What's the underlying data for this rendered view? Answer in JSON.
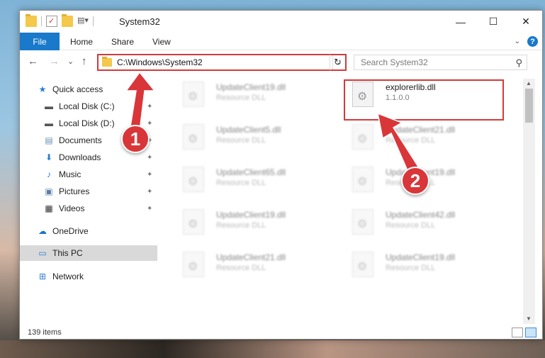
{
  "window": {
    "title": "System32",
    "controls": {
      "minimize": "—",
      "maximize": "☐",
      "close": "✕"
    }
  },
  "ribbon": {
    "tabs": [
      "File",
      "Home",
      "Share",
      "View"
    ],
    "help": "?"
  },
  "navbar": {
    "back": "←",
    "forward": "→",
    "recent": "⌄",
    "up": "↑",
    "address": "C:\\Windows\\System32",
    "refresh": "↻",
    "search_placeholder": "Search System32",
    "search_icon": "⚲"
  },
  "sidebar": {
    "items": [
      {
        "label": "Quick access",
        "icon": "star-icon",
        "glyph": "★",
        "color": "#2b7bd5",
        "pinned": false
      },
      {
        "label": "Local Disk (C:)",
        "icon": "drive-icon",
        "glyph": "▬",
        "color": "#555555",
        "pinned": true
      },
      {
        "label": "Local Disk (D:)",
        "icon": "drive-icon",
        "glyph": "▬",
        "color": "#555555",
        "pinned": true
      },
      {
        "label": "Documents",
        "icon": "documents-icon",
        "glyph": "▤",
        "color": "#6a8fb5",
        "pinned": true
      },
      {
        "label": "Downloads",
        "icon": "downloads-icon",
        "glyph": "⬇",
        "color": "#2b7bd5",
        "pinned": true
      },
      {
        "label": "Music",
        "icon": "music-icon",
        "glyph": "♪",
        "color": "#2b7bd5",
        "pinned": true
      },
      {
        "label": "Pictures",
        "icon": "pictures-icon",
        "glyph": "▣",
        "color": "#5a7ea6",
        "pinned": true
      },
      {
        "label": "Videos",
        "icon": "videos-icon",
        "glyph": "▦",
        "color": "#333333",
        "pinned": true
      },
      {
        "label": "OneDrive",
        "icon": "onedrive-icon",
        "glyph": "☁",
        "color": "#1d72c9",
        "pinned": false
      },
      {
        "label": "This PC",
        "icon": "computer-icon",
        "glyph": "▭",
        "color": "#2b7bd5",
        "pinned": false
      },
      {
        "label": "Network",
        "icon": "network-icon",
        "glyph": "⊞",
        "color": "#2b7bd5",
        "pinned": false
      }
    ],
    "pin_glyph": "📌"
  },
  "files": [
    {
      "name": "UpdateClient19.dll",
      "desc": "Resource DLL",
      "blurred": true
    },
    {
      "name": "explorerlib.dll",
      "desc": "1.1.0.0",
      "blurred": false
    },
    {
      "name": "UpdateClient5.dll",
      "desc": "Resource DLL",
      "blurred": true
    },
    {
      "name": "UpdateClient21.dll",
      "desc": "Resource DLL",
      "blurred": true
    },
    {
      "name": "UpdateClient65.dll",
      "desc": "Resource DLL",
      "blurred": true
    },
    {
      "name": "UpdateClient19.dll",
      "desc": "Resource DLL",
      "blurred": true
    },
    {
      "name": "UpdateClient19.dll",
      "desc": "Resource DLL",
      "blurred": true
    },
    {
      "name": "UpdateClient42.dll",
      "desc": "Resource DLL",
      "blurred": true
    },
    {
      "name": "UpdateClient21.dll",
      "desc": "Resource DLL",
      "blurred": true
    },
    {
      "name": "UpdateClient19.dll",
      "desc": "Resource DLL",
      "blurred": true
    }
  ],
  "status": {
    "item_count": "139 items"
  },
  "callouts": {
    "step1": "1",
    "step2": "2",
    "color": "#d9363a"
  }
}
